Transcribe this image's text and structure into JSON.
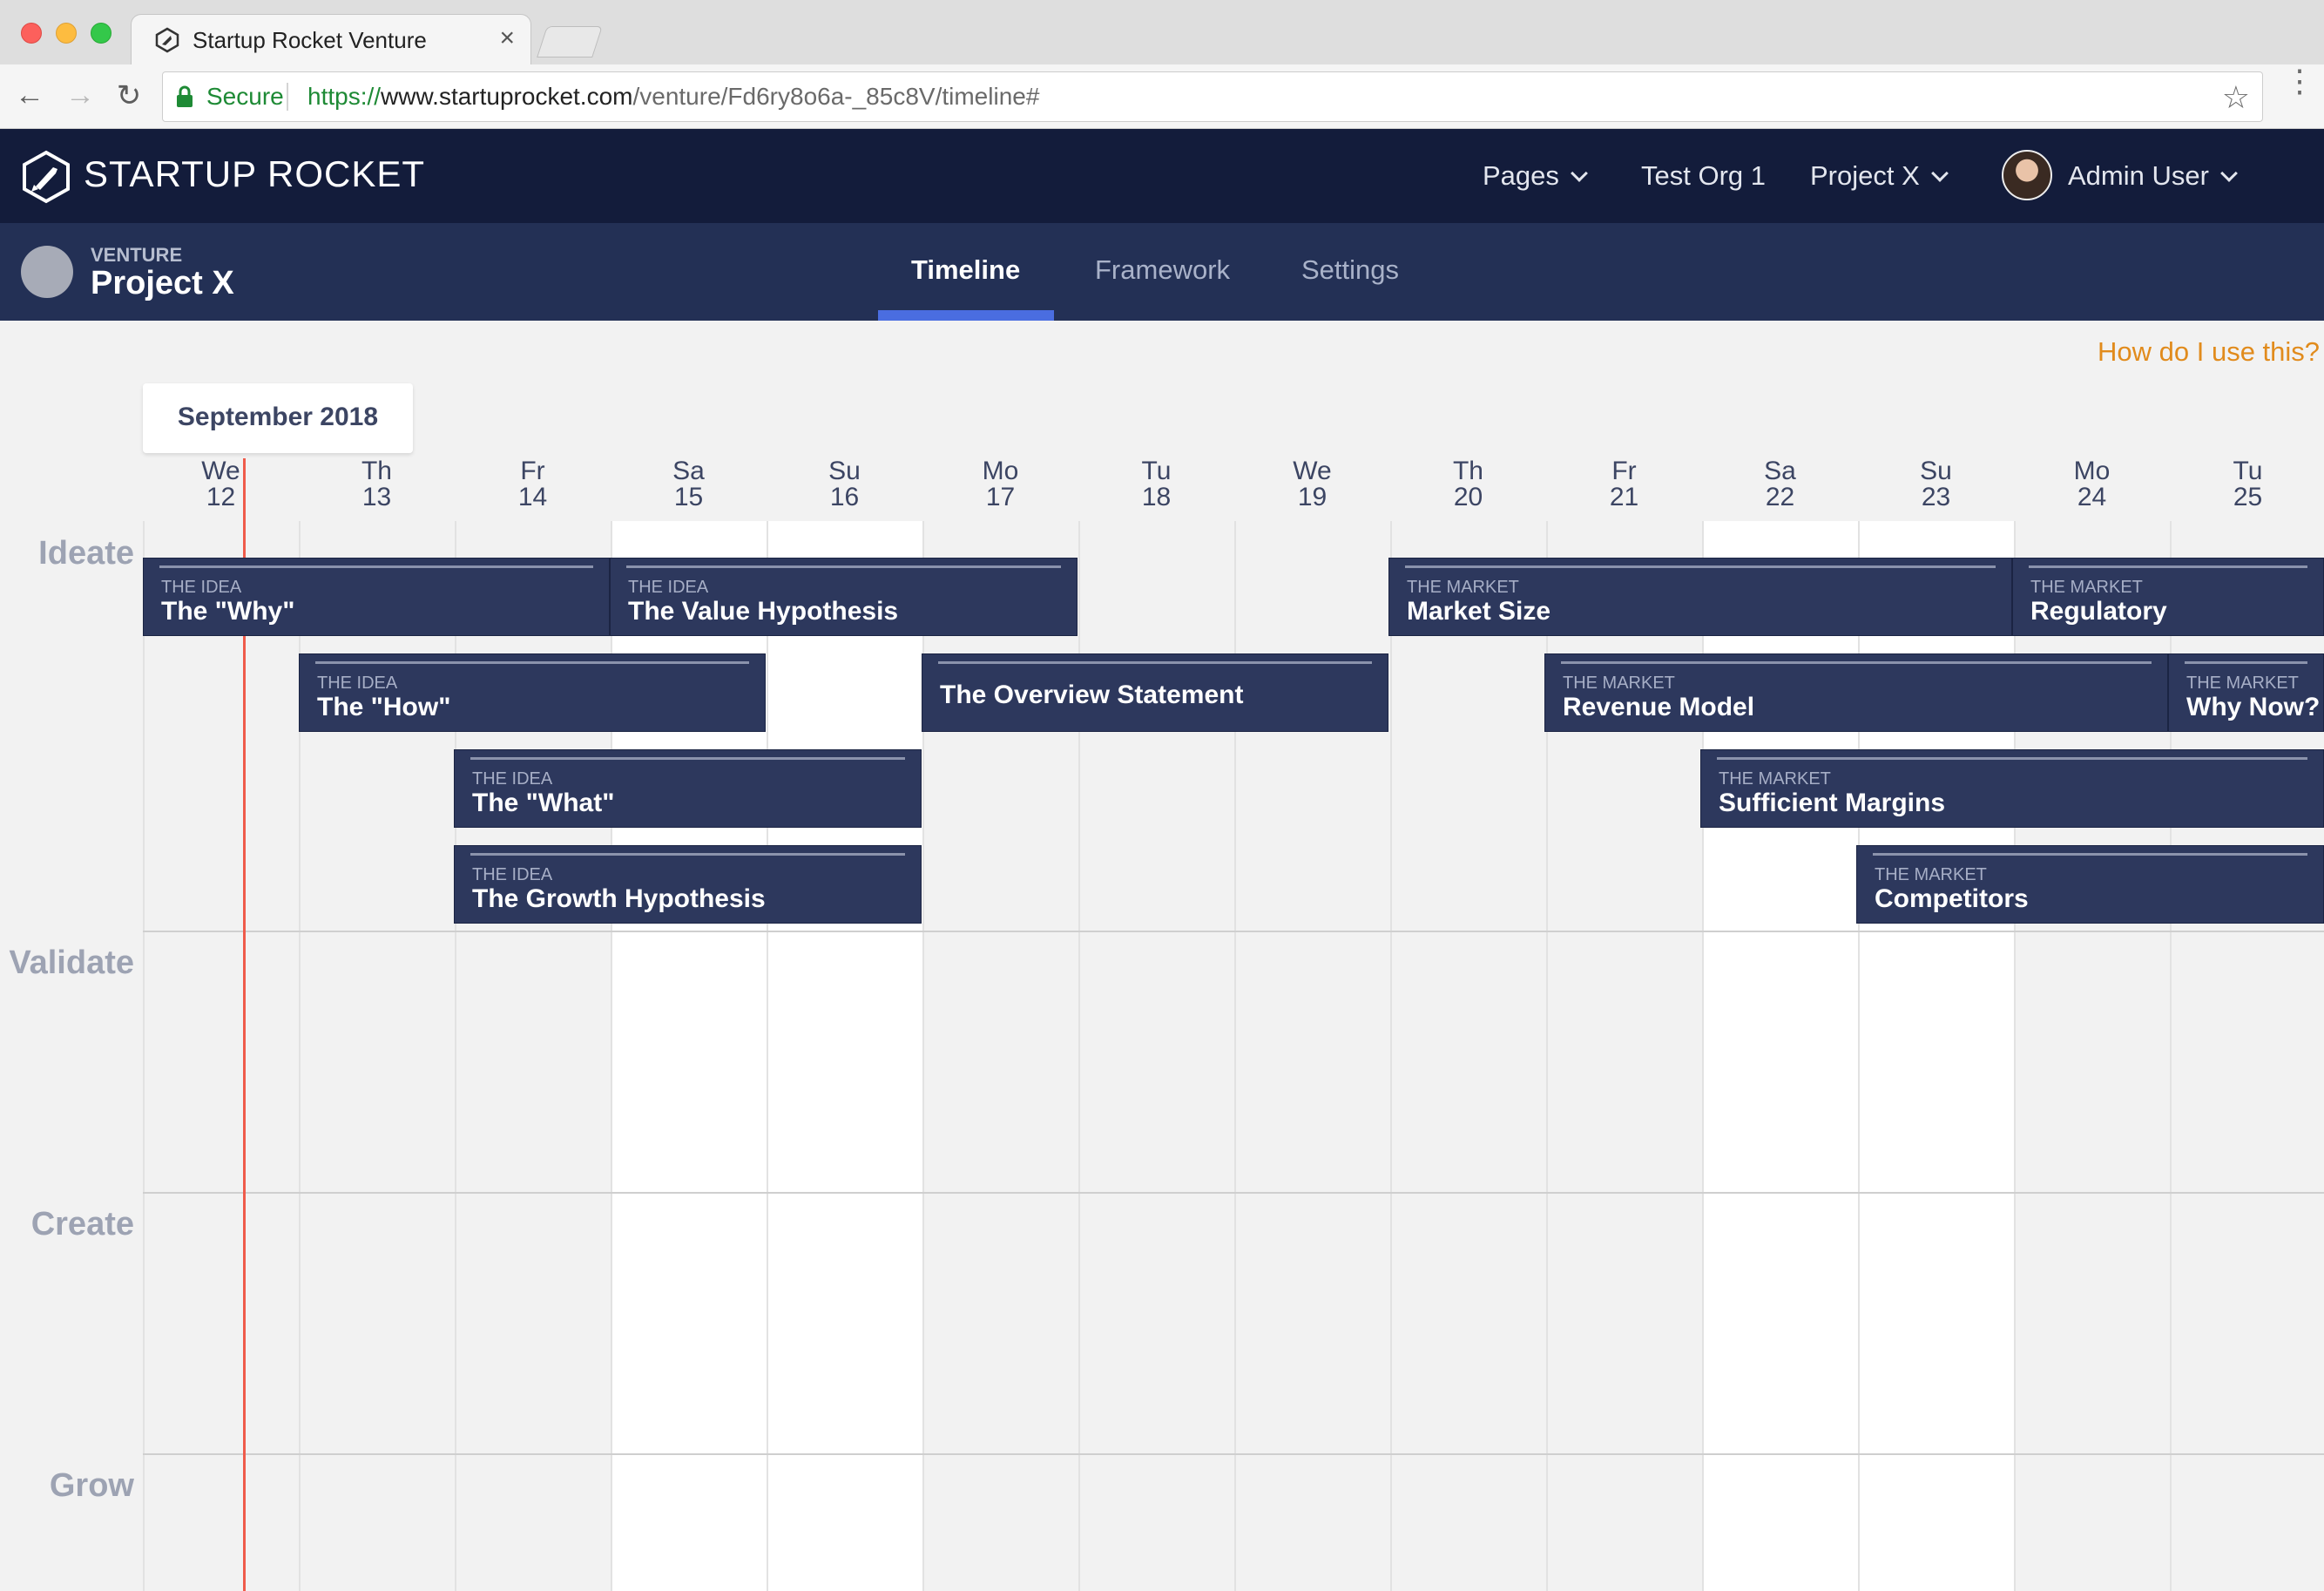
{
  "browser": {
    "tab_title": "Startup Rocket Venture",
    "tab_close": "×",
    "secure_label": "Secure",
    "url_scheme": "https://",
    "url_host": "www.startuprocket.com",
    "url_path": "/venture/Fd6ry8o6a-_85c8V/timeline#",
    "back": "←",
    "forward": "→",
    "reload": "↻",
    "star": "☆",
    "menu": "⋮"
  },
  "header": {
    "logo_text": "STARTUP ROCKET",
    "menu": [
      {
        "label": "Pages",
        "dropdown": true
      },
      {
        "label": "Test Org 1",
        "dropdown": false
      },
      {
        "label": "Project X",
        "dropdown": true
      }
    ],
    "user_name": "Admin User"
  },
  "venture": {
    "label": "VENTURE",
    "name": "Project X",
    "tabs": [
      {
        "label": "Timeline",
        "active": true
      },
      {
        "label": "Framework",
        "active": false
      },
      {
        "label": "Settings",
        "active": false
      }
    ]
  },
  "timeline": {
    "help_link": "How do I use this?",
    "month": "September 2018",
    "days": [
      {
        "dow": "We",
        "date": "12"
      },
      {
        "dow": "Th",
        "date": "13"
      },
      {
        "dow": "Fr",
        "date": "14"
      },
      {
        "dow": "Sa",
        "date": "15"
      },
      {
        "dow": "Su",
        "date": "16"
      },
      {
        "dow": "Mo",
        "date": "17"
      },
      {
        "dow": "Tu",
        "date": "18"
      },
      {
        "dow": "We",
        "date": "19"
      },
      {
        "dow": "Th",
        "date": "20"
      },
      {
        "dow": "Fr",
        "date": "21"
      },
      {
        "dow": "Sa",
        "date": "22"
      },
      {
        "dow": "Su",
        "date": "23"
      },
      {
        "dow": "Mo",
        "date": "24"
      },
      {
        "dow": "Tu",
        "date": "25"
      }
    ],
    "phases": [
      "Ideate",
      "Validate",
      "Create",
      "Grow"
    ],
    "cards": [
      {
        "category": "THE IDEA",
        "title": "The \"Why\""
      },
      {
        "category": "THE IDEA",
        "title": "The Value Hypothesis"
      },
      {
        "category": "THE MARKET",
        "title": "Market Size"
      },
      {
        "category": "THE MARKET",
        "title": "Regulatory"
      },
      {
        "category": "THE IDEA",
        "title": "The \"How\""
      },
      {
        "category": "",
        "title": "The Overview Statement"
      },
      {
        "category": "THE MARKET",
        "title": "Revenue Model"
      },
      {
        "category": "THE MARKET",
        "title": "Why Now?"
      },
      {
        "category": "THE IDEA",
        "title": "The \"What\""
      },
      {
        "category": "THE MARKET",
        "title": "Sufficient Margins"
      },
      {
        "category": "THE IDEA",
        "title": "The Growth Hypothesis"
      },
      {
        "category": "THE MARKET",
        "title": "Competitors"
      }
    ]
  }
}
